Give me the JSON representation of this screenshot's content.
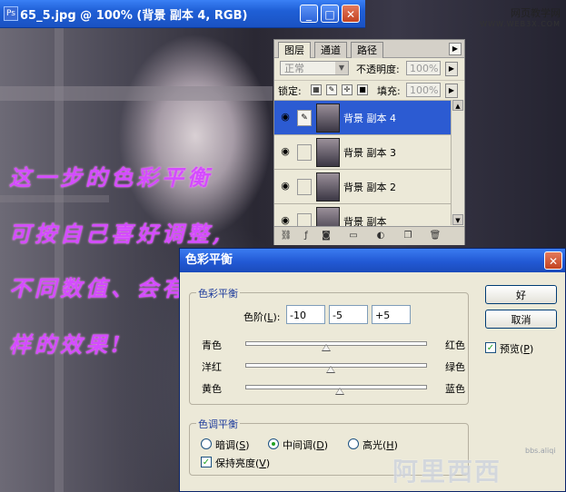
{
  "window": {
    "title": "65_5.jpg @ 100% (背景 副本 4, RGB)",
    "minimize_icon": "minimize-icon",
    "maximize_icon": "maximize-icon",
    "close_icon": "close-icon"
  },
  "watermark": {
    "text": "网页教学网",
    "sub": "WWW.WEB3X.COM"
  },
  "layers_panel": {
    "tabs": [
      "图层",
      "通道",
      "路径"
    ],
    "blend_mode": "正常",
    "opacity_label": "不透明度:",
    "opacity_value": "100%",
    "lock_label": "锁定:",
    "fill_label": "填充:",
    "fill_value": "100%",
    "layers": [
      {
        "name": "背景 副本 4",
        "selected": true
      },
      {
        "name": "背景 副本 3",
        "selected": false
      },
      {
        "name": "背景 副本 2",
        "selected": false
      },
      {
        "name": "背景 副本",
        "selected": false
      }
    ]
  },
  "handwriting": [
    "这一步的色彩平衡",
    "可按自己喜好调整,",
    "不同数值、会有不一",
    "样的效果!"
  ],
  "dialog": {
    "title": "色彩平衡",
    "color_balance_group": "色彩平衡",
    "levels_label": "色阶(",
    "levels_key": "L",
    "levels_suffix": "):",
    "levels": [
      "-10",
      "-5",
      "+5"
    ],
    "sliders": [
      {
        "left": "青色",
        "right": "红色",
        "value": -10
      },
      {
        "left": "洋红",
        "right": "绿色",
        "value": -5
      },
      {
        "left": "黄色",
        "right": "蓝色",
        "value": 5
      }
    ],
    "ok_label": "好",
    "cancel_label": "取消",
    "preview_label": "预览(",
    "preview_key": "P",
    "preview_suffix": ")",
    "tone_group": "色调平衡",
    "tones": [
      {
        "label": "暗调(",
        "key": "S",
        "suffix": ")",
        "selected": false
      },
      {
        "label": "中间调(",
        "key": "D",
        "suffix": ")",
        "selected": true
      },
      {
        "label": "高光(",
        "key": "H",
        "suffix": ")",
        "selected": false
      }
    ],
    "preserve_label": "保持亮度(",
    "preserve_key": "V",
    "preserve_suffix": ")"
  },
  "logo": {
    "text": "阿里西西",
    "sub": "bbs.aliqi"
  }
}
